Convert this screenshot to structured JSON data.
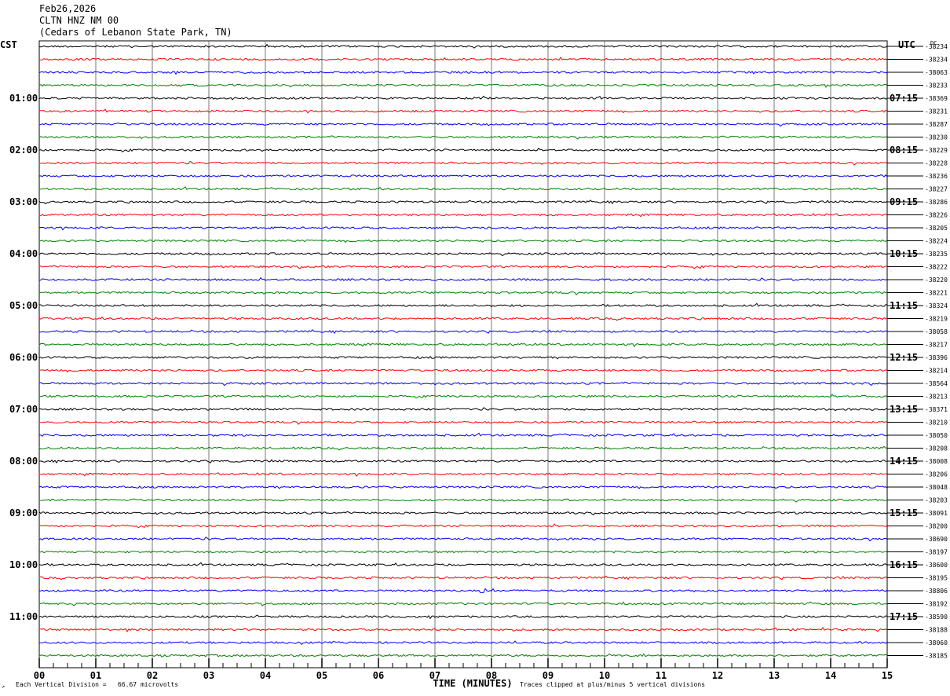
{
  "header": {
    "date": "Feb26,2026",
    "station": "CLTN HNZ NM 00",
    "location": "(Cedars of Lebanon State Park, TN)"
  },
  "chart_data": {
    "type": "helicorder",
    "left_timezone": "CST",
    "right_timezone": "UTC",
    "dc_label": "DC",
    "xlabel": "TIME (MINUTES)",
    "x_ticks": [
      "00",
      "01",
      "02",
      "03",
      "04",
      "05",
      "06",
      "07",
      "08",
      "09",
      "10",
      "11",
      "12",
      "13",
      "14",
      "15"
    ],
    "xlim": [
      0,
      15
    ],
    "trace_colors": [
      "#000000",
      "#ff0000",
      "#0000ff",
      "#008000"
    ],
    "left_hour_labels": [
      "01:00",
      "02:00",
      "03:00",
      "04:00",
      "05:00",
      "06:00",
      "07:00",
      "08:00",
      "09:00",
      "10:00",
      "11:00"
    ],
    "right_hour_labels": [
      "07:15",
      "08:15",
      "09:15",
      "10:15",
      "11:15",
      "12:15",
      "13:15",
      "14:15",
      "15:15",
      "16:15",
      "17:15"
    ],
    "trace_dc_offsets": [
      "-38234",
      "-38234",
      "-38063",
      "-38233",
      "-38369",
      "-38231",
      "-38287",
      "-38230",
      "-38229",
      "-38228",
      "-38236",
      "-38227",
      "-38286",
      "-38226",
      "-38205",
      "-38224",
      "-38235",
      "-38222",
      "-38220",
      "-38221",
      "-38324",
      "-38219",
      "-38058",
      "-38217",
      "-38396",
      "-38214",
      "-38564",
      "-38213",
      "-38371",
      "-38210",
      "-38050",
      "-38208",
      "-38008",
      "-38206",
      "-38048",
      "-38203",
      "-38091",
      "-38200",
      "-38690",
      "-38197",
      "-38600",
      "-38195",
      "-38806",
      "-38192",
      "-38590",
      "-38188",
      "-38060",
      "-38185"
    ],
    "event": {
      "trace_index": 42,
      "minute": 7.85
    }
  },
  "footer": {
    "scale_note": "Each Vertical Division =   66.67 microvolts",
    "clip_note": "Traces clipped at plus/minus 5 vertical divisions"
  }
}
